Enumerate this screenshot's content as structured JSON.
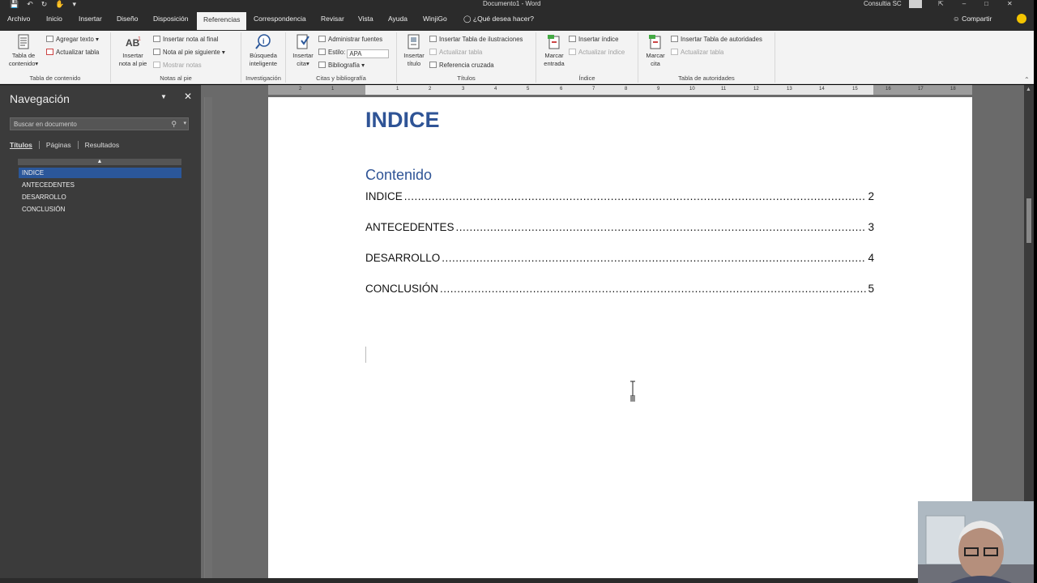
{
  "window": {
    "title": "Documento1 - Word",
    "account": "Consultia SC",
    "quick_access": [
      "save-icon",
      "undo-icon",
      "redo-icon",
      "touch-mode-icon",
      "customize-icon"
    ]
  },
  "tabs": {
    "items": [
      "Archivo",
      "Inicio",
      "Insertar",
      "Diseño",
      "Disposición",
      "Referencias",
      "Correspondencia",
      "Revisar",
      "Vista",
      "Ayuda",
      "WinjiGo"
    ],
    "active": "Referencias",
    "tell_me": "¿Qué desea hacer?",
    "share": "Compartir"
  },
  "ribbon": {
    "toc": {
      "big_label_1": "Tabla de",
      "big_label_2": "contenido",
      "add_text": "Agregar texto",
      "update_table": "Actualizar tabla",
      "group": "Tabla de contenido"
    },
    "footnotes": {
      "big_label_1": "Insertar",
      "big_label_2": "nota al pie",
      "insert_endnote": "Insertar nota al final",
      "next_footnote": "Nota al pie siguiente",
      "show_notes": "Mostrar notas",
      "group": "Notas al pie"
    },
    "research": {
      "big_label_1": "Búsqueda",
      "big_label_2": "inteligente",
      "group": "Investigación"
    },
    "citations": {
      "big_label_1": "Insertar",
      "big_label_2": "cita",
      "manage_sources": "Administrar fuentes",
      "style_label": "Estilo:",
      "style_value": "APA",
      "bibliography": "Bibliografía",
      "group": "Citas y bibliografía"
    },
    "captions": {
      "big_label_1": "Insertar",
      "big_label_2": "título",
      "insert_table_figures": "Insertar Tabla de ilustraciones",
      "update_table": "Actualizar tabla",
      "cross_reference": "Referencia cruzada",
      "group": "Títulos"
    },
    "index": {
      "big_label_1": "Marcar",
      "big_label_2": "entrada",
      "insert_index": "Insertar índice",
      "update_index": "Actualizar índice",
      "group": "Índice"
    },
    "authorities": {
      "big_label_1": "Marcar",
      "big_label_2": "cita",
      "insert_table": "Insertar Tabla de autoridades",
      "update_table": "Actualizar tabla",
      "group": "Tabla de autoridades"
    }
  },
  "nav_pane": {
    "title": "Navegación",
    "search_placeholder": "Buscar en documento",
    "tabs": [
      "Títulos",
      "Páginas",
      "Resultados"
    ],
    "headings": [
      "INDICE",
      "ANTECEDENTES",
      "DESARROLLO",
      "CONCLUSIÓN"
    ],
    "selected": "INDICE"
  },
  "ruler": {
    "ticks": [
      "2",
      "1",
      "1",
      "2",
      "3",
      "4",
      "5",
      "6",
      "7",
      "8",
      "9",
      "10",
      "11",
      "12",
      "13",
      "14",
      "15",
      "16",
      "17",
      "18"
    ]
  },
  "document": {
    "heading": "INDICE",
    "toc_heading": "Contenido",
    "toc": [
      {
        "label": "INDICE",
        "page": "2"
      },
      {
        "label": "ANTECEDENTES",
        "page": "3"
      },
      {
        "label": "DESARROLLO",
        "page": "4"
      },
      {
        "label": "CONCLUSIÓN",
        "page": "5"
      }
    ]
  },
  "colors": {
    "accent": "#2b579a",
    "heading": "#2f5496",
    "chrome_dark": "#2b2b2b"
  }
}
